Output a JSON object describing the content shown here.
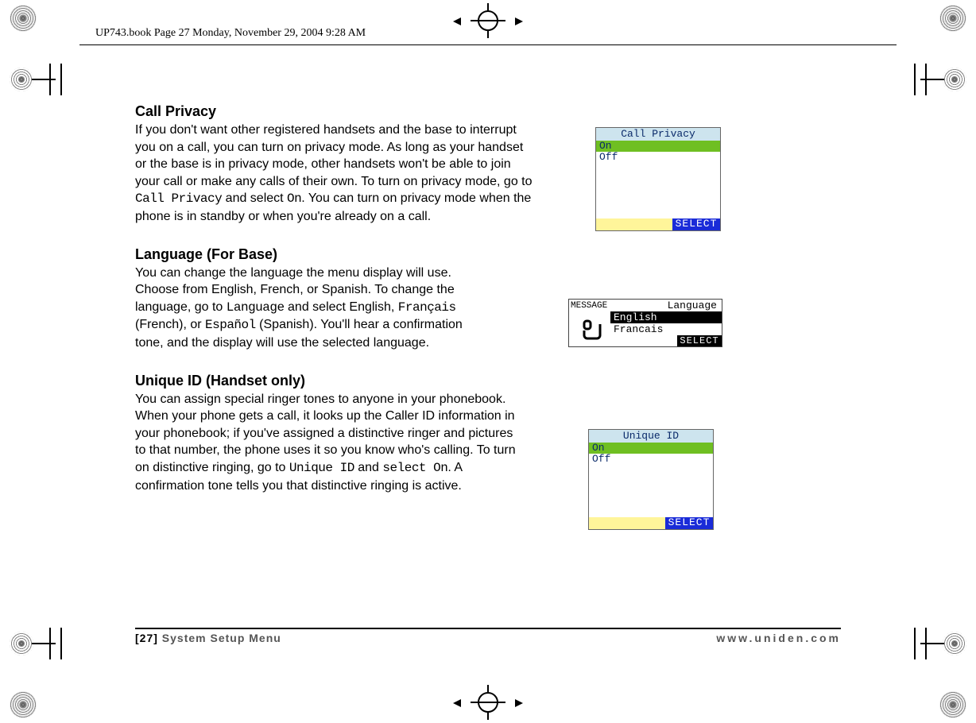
{
  "print_header": "UP743.book  Page 27  Monday, November 29, 2004  9:28 AM",
  "sections": {
    "call_privacy": {
      "title": "Call Privacy",
      "body_pre": "If you don't want other registered handsets and the base to interrupt you on a call, you can turn on privacy mode. As long as your handset or the base is in privacy mode, other handsets won't be able to join your call or make any calls of their own. To turn on privacy mode, go to ",
      "menu1": "Call Privacy",
      "mid": " and select ",
      "menu2": "On",
      "body_post": ". You can turn on privacy mode when the phone is in standby or when you're already on a call."
    },
    "language": {
      "title": "Language (For Base)",
      "body_pre": "You can change the language the menu display will use. Choose from English, French, or Spanish. To change the language, go to ",
      "menu1": "Language",
      "mid1": " and select English, ",
      "menu2": "Français",
      "mid2": " (French), or ",
      "menu3": "Español",
      "body_post": " (Spanish). You'll hear a confirmation tone, and the display will use the selected language."
    },
    "unique_id": {
      "title": "Unique ID (Handset only)",
      "body_pre": "You can assign special ringer tones to anyone in your phonebook. When your phone gets a call, it looks up the Caller ID information in your phonebook; if you've assigned a distinctive ringer and pictures to that number, the phone uses it so you know who's calling. To turn on distinctive ringing, go to ",
      "menu1": "Unique ID",
      "mid": " and ",
      "menu2": "select On",
      "body_post": ". A confirmation tone tells you that distinctive ringing is active."
    }
  },
  "screens": {
    "call_privacy": {
      "title": "Call Privacy",
      "options": [
        "On",
        "Off"
      ],
      "selected_index": 0,
      "softkey_right": "SELECT"
    },
    "language": {
      "badge": "MESSAGE",
      "title": "Language",
      "options": [
        "English",
        "Francais"
      ],
      "selected_index": 0,
      "softkey_right": "SELECT"
    },
    "unique_id": {
      "title": "Unique ID",
      "options": [
        "On",
        "Off"
      ],
      "selected_index": 0,
      "softkey_right": "SELECT"
    }
  },
  "footer": {
    "page": "[27]",
    "section": "System Setup Menu",
    "url": "www.uniden.com"
  }
}
